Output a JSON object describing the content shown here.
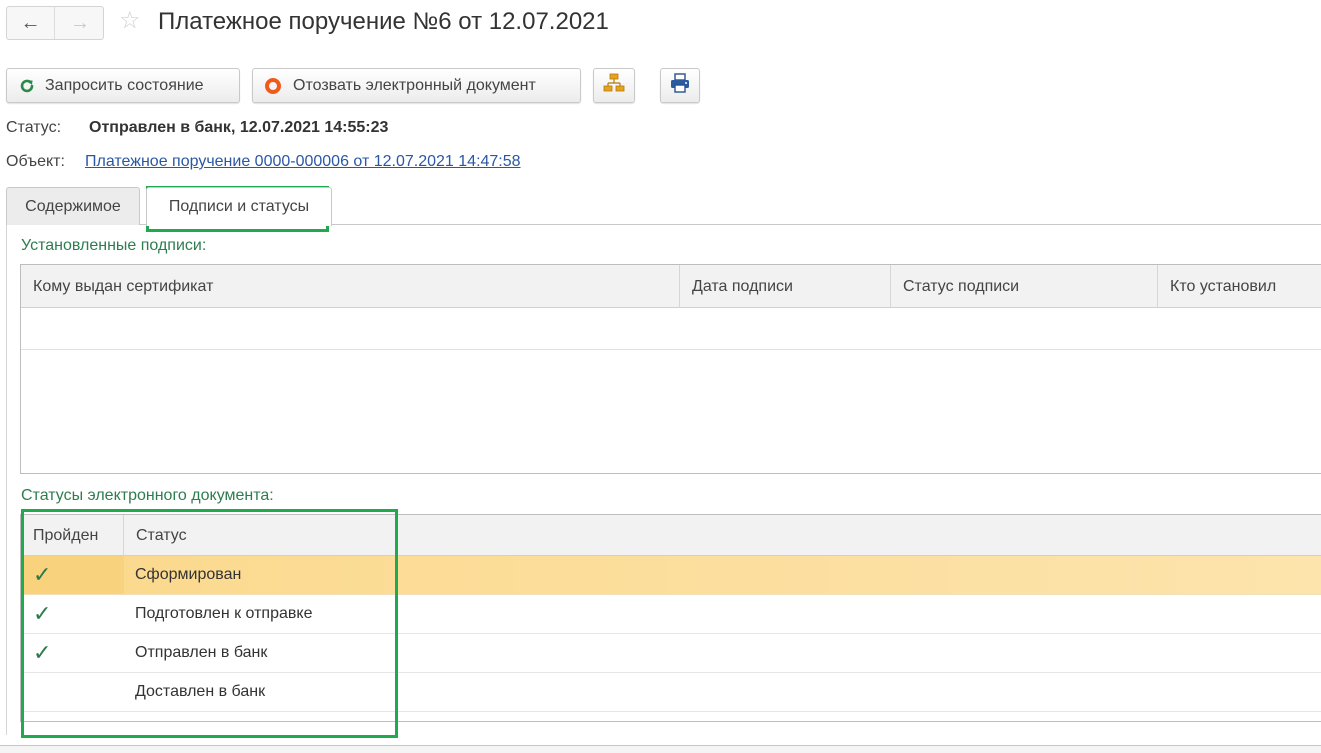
{
  "window": {
    "title": "Платежное поручение №6 от 12.07.2021",
    "back_icon": "←",
    "forward_icon": "→",
    "favorite_icon": "☆"
  },
  "toolbar": {
    "refresh_label": "Запросить состояние",
    "revoke_label": "Отозвать электронный документ"
  },
  "info": {
    "status_label": "Статус:",
    "status_value": "Отправлен в банк, 12.07.2021 14:55:23",
    "object_label": "Объект:",
    "object_link": "Платежное поручение 0000-000006 от 12.07.2021 14:47:58"
  },
  "tabs": [
    {
      "label": "Содержимое",
      "active": false
    },
    {
      "label": "Подписи и статусы",
      "active": true
    }
  ],
  "signatures": {
    "title": "Установленные подписи:",
    "columns": [
      "Кому выдан сертификат",
      "Дата подписи",
      "Статус подписи",
      "Кто установил"
    ],
    "rows": []
  },
  "statuses": {
    "title": "Статусы электронного документа:",
    "columns": [
      "Пройден",
      "Статус"
    ],
    "rows": [
      {
        "passed": true,
        "status": "Сформирован",
        "selected": true
      },
      {
        "passed": true,
        "status": "Подготовлен к отправке",
        "selected": false
      },
      {
        "passed": true,
        "status": "Отправлен в банк",
        "selected": false
      },
      {
        "passed": false,
        "status": "Доставлен в банк",
        "selected": false
      }
    ]
  },
  "colors": {
    "accent_green": "#1faa4f",
    "section_title": "#2e7d4f",
    "link": "#2a57a5",
    "selected_row": "#fbd98c",
    "revoke_icon": "#f05a1a",
    "refresh_icon": "#2b8a4a"
  }
}
